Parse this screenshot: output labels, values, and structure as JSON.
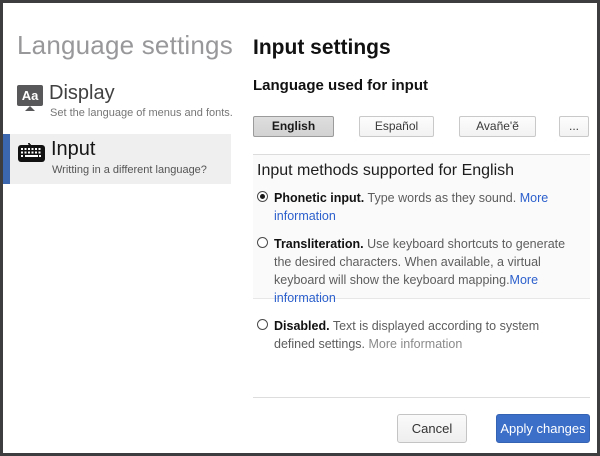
{
  "sidebar": {
    "title": "Language settings",
    "items": [
      {
        "label": "Display",
        "subtitle": "Set the language of menus and fonts.",
        "icon": "display-aa-icon",
        "icon_text": "Aa",
        "active": false
      },
      {
        "label": "Input",
        "subtitle": "Writting in a different language?",
        "icon": "keyboard-icon",
        "active": true
      }
    ]
  },
  "main": {
    "title": "Input settings",
    "language_section_title": "Language used for input",
    "language_buttons": [
      {
        "label": "English",
        "selected": true
      },
      {
        "label": "Español",
        "selected": false
      },
      {
        "label": "Avañe'ẽ",
        "selected": false
      },
      {
        "label": "...",
        "selected": false
      }
    ],
    "methods": {
      "title": "Input methods supported for English",
      "options": [
        {
          "name": "Phonetic input.",
          "description": " Type words as they sound. ",
          "link": "More information",
          "link_style": "blue",
          "selected": true
        },
        {
          "name": "Transliteration.",
          "description": " Use keyboard shortcuts to generate the desired characters. When available, a virtual keyboard will show the keyboard mapping.",
          "link": "More information",
          "link_style": "blue",
          "selected": false
        },
        {
          "name": "Disabled.",
          "description": " Text is displayed according to system defined settings. ",
          "link": "More information",
          "link_style": "gray",
          "selected": false
        }
      ]
    },
    "footer": {
      "cancel_label": "Cancel",
      "apply_label": "Apply changes"
    }
  },
  "colors": {
    "frame_border": "#3d3d3f",
    "sidebar_title_gray": "#98989b",
    "active_item_bg": "#efefef",
    "active_item_bar_blue": "#3a67b0",
    "selected_lang_btn_bg": "#d8d8d8",
    "panel_bg": "#fafafa",
    "link_blue": "#2b5fcc",
    "apply_button_bg": "#3c6fc8",
    "apply_button_text": "#ffffff"
  }
}
